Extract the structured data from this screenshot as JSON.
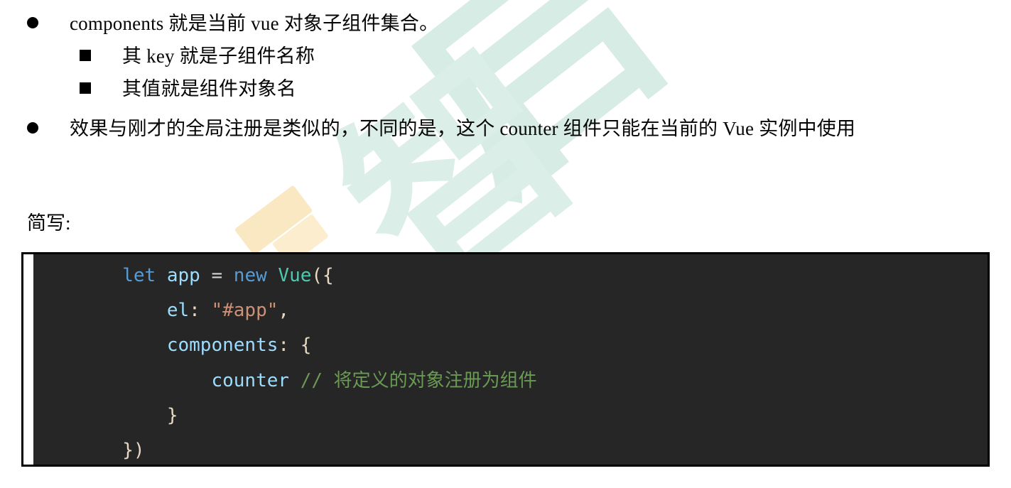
{
  "document": {
    "background_color": "#ffffff",
    "text_color": "#050505"
  },
  "watermark": {
    "glyph_main": "启",
    "glyph_second": "智",
    "color": "#d6ece5",
    "accent_color": "#fae8c2"
  },
  "bullets": [
    {
      "level": 1,
      "marker": "disc-bullet",
      "text": "components 就是当前 vue 对象子组件集合。"
    },
    {
      "level": 2,
      "marker": "square-bullet",
      "text": "其 key 就是子组件名称"
    },
    {
      "level": 2,
      "marker": "square-bullet",
      "text": "其值就是组件对象名"
    },
    {
      "level": 1,
      "marker": "disc-bullet",
      "text": "效果与刚才的全局注册是类似的，不同的是，这个 counter 组件只能在当前的 Vue 实例中使用"
    }
  ],
  "section_label": "简写:",
  "code_block": {
    "background_color": "#262626",
    "border_color": "#000000",
    "language": "javascript",
    "colors": {
      "keyword": "#569cd6",
      "variable": "#9cdcfe",
      "class": "#4ec9b0",
      "string": "#ce9178",
      "punctuation": "#e8d8c0",
      "comment": "#6a9955"
    },
    "lines": [
      {
        "indent": "        ",
        "tokens": [
          {
            "t": "let",
            "c": "kw"
          },
          {
            "t": " ",
            "c": "op"
          },
          {
            "t": "app",
            "c": "var"
          },
          {
            "t": " ",
            "c": "op"
          },
          {
            "t": "=",
            "c": "op"
          },
          {
            "t": " ",
            "c": "op"
          },
          {
            "t": "new",
            "c": "kw"
          },
          {
            "t": " ",
            "c": "op"
          },
          {
            "t": "Vue",
            "c": "class"
          },
          {
            "t": "({",
            "c": "punct"
          }
        ]
      },
      {
        "indent": "            ",
        "tokens": [
          {
            "t": "el",
            "c": "var"
          },
          {
            "t": ":",
            "c": "punct"
          },
          {
            "t": " ",
            "c": "op"
          },
          {
            "t": "\"#app\"",
            "c": "str"
          },
          {
            "t": ",",
            "c": "punct"
          }
        ]
      },
      {
        "indent": "            ",
        "tokens": [
          {
            "t": "components",
            "c": "var"
          },
          {
            "t": ":",
            "c": "punct"
          },
          {
            "t": " ",
            "c": "op"
          },
          {
            "t": "{",
            "c": "punct"
          }
        ]
      },
      {
        "indent": "                ",
        "tokens": [
          {
            "t": "counter",
            "c": "var"
          },
          {
            "t": " ",
            "c": "op"
          },
          {
            "t": "// ",
            "c": "comment"
          },
          {
            "t": "将定义的对象注册为组件",
            "c": "comment-cjk"
          }
        ]
      },
      {
        "indent": "            ",
        "tokens": [
          {
            "t": "}",
            "c": "punct"
          }
        ]
      },
      {
        "indent": "        ",
        "tokens": [
          {
            "t": "})",
            "c": "punct"
          }
        ]
      }
    ],
    "plain_text": "        let app = new Vue({\n            el: \"#app\",\n            components: {\n                counter // 将定义的对象注册为组件\n            }\n        })"
  }
}
